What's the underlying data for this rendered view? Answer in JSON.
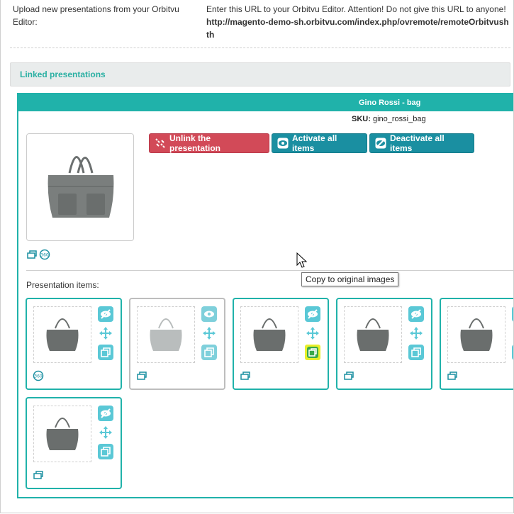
{
  "upload": {
    "label": "Upload new presentations from your Orbitvu Editor:",
    "instruction": "Enter this URL to your Orbitvu Editor. Attention! Do not give this URL to anyone!",
    "url": "http://magento-demo-sh.orbitvu.com/index.php/ovremote/remoteOrbitvush",
    "url_wrap": "th"
  },
  "section": {
    "title": "Linked presentations"
  },
  "presentation": {
    "title": "Gino Rossi - bag",
    "sku_label": "SKU:",
    "sku_value": "gino_rossi_bag",
    "buttons": {
      "unlink": "Unlink the presentation",
      "activate": "Activate all items",
      "deactivate": "Deactivate all items"
    },
    "items_label": "Presentation items:",
    "items": [
      {
        "status": "active",
        "type": "360-icon"
      },
      {
        "status": "inactive",
        "type": "photo-icon"
      },
      {
        "status": "active",
        "type": "photo-icon"
      },
      {
        "status": "active",
        "type": "photo-icon"
      },
      {
        "status": "active",
        "type": "photo-icon"
      },
      {
        "status": "active",
        "type": "photo-icon"
      }
    ]
  },
  "tooltip": {
    "text": "Copy to original images"
  },
  "colors": {
    "teal": "#20b2aa",
    "unlink_red": "#d24a58",
    "action_blue": "#1a8fa1",
    "control_cyan": "#5ac8d6",
    "highlight_yellow": "#e8ef2a"
  }
}
